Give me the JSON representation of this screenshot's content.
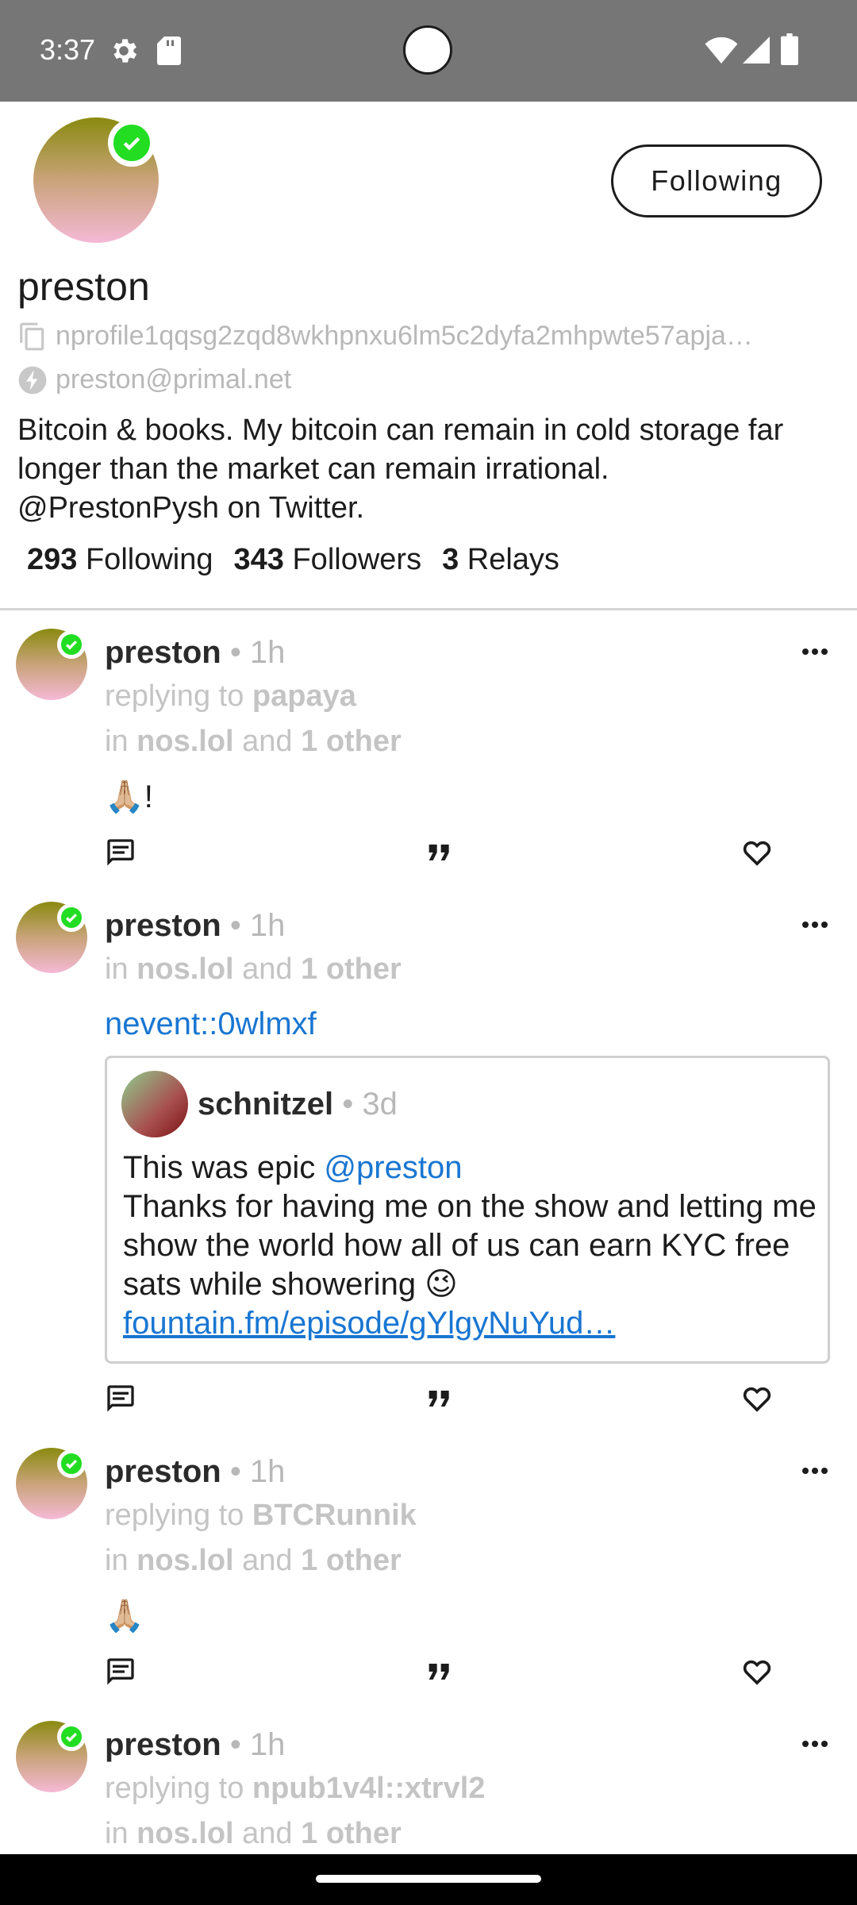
{
  "status_bar": {
    "time": "3:37",
    "icons": [
      "settings-icon",
      "sd-card-icon",
      "wifi-icon",
      "signal-icon",
      "battery-icon"
    ]
  },
  "profile": {
    "name": "preston",
    "npub": "nprofile1qqsg2zqd8wkhpnxu6lm5c2dyfa2mhpwte57apja…",
    "nip05": "preston@primal.net",
    "bio": "Bitcoin & books. My bitcoin can remain in cold storage far longer than the market can remain irrational. @PrestonPysh on Twitter.",
    "follow_button": "Following",
    "stats": {
      "following_count": "293",
      "following_label": "Following",
      "followers_count": "343",
      "followers_label": "Followers",
      "relays_count": "3",
      "relays_label": "Relays"
    }
  },
  "posts": [
    {
      "author": "preston",
      "time": "• 1h",
      "replying_prefix": "replying to ",
      "replying_to": "papaya",
      "in_prefix": "in ",
      "relay": "nos.lol",
      "and_text": " and ",
      "others": "1 other",
      "text": "🙏🏼!"
    },
    {
      "author": "preston",
      "time": "• 1h",
      "in_prefix": "in ",
      "relay": "nos.lol",
      "and_text": " and ",
      "others": "1 other",
      "link": "nevent::0wlmxf",
      "quote": {
        "author": "schnitzel",
        "time": "• 3d",
        "text_pre": "This was epic ",
        "mention": "@preston",
        "text_body": "Thanks for having me on the show and letting me show the world how all of us can earn KYC free sats while showering 😉",
        "link": "fountain.fm/episode/gYlgyNuYud…"
      }
    },
    {
      "author": "preston",
      "time": "• 1h",
      "replying_prefix": "replying to ",
      "replying_to": "BTCRunnik",
      "in_prefix": "in ",
      "relay": "nos.lol",
      "and_text": " and ",
      "others": "1 other",
      "text": "🙏🏼"
    },
    {
      "author": "preston",
      "time": "• 1h",
      "replying_prefix": "replying to ",
      "replying_to": "npub1v4l::xtrvl2",
      "in_prefix": "in ",
      "relay": "nos.lol",
      "and_text": " and ",
      "others": "1 other"
    }
  ],
  "colors": {
    "link": "#1976d2",
    "verified": "#22dd22",
    "muted": "#c4c4c4",
    "status_bar": "#767676"
  }
}
